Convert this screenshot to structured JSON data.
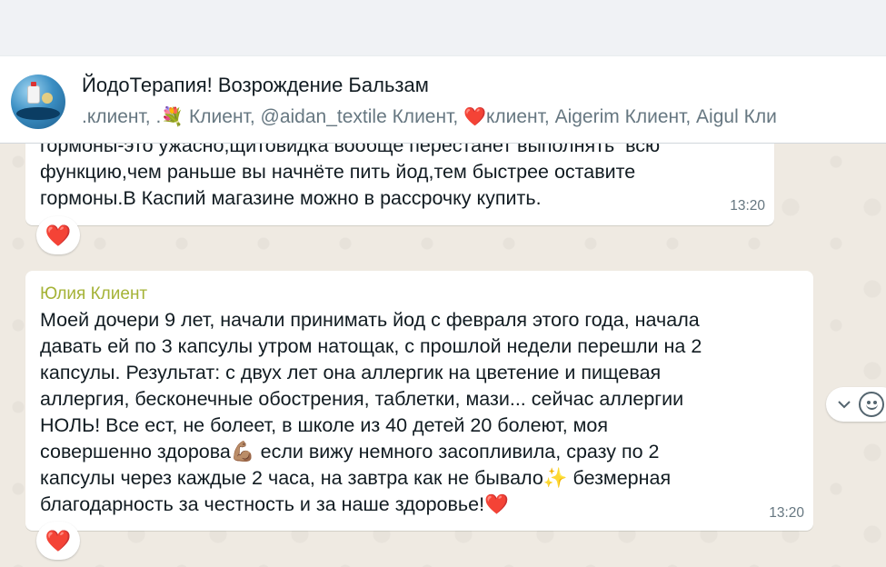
{
  "header": {
    "title": "ЙодоТерапия! Возрождение Бальзам",
    "members": [
      {
        "text": ".клиент, ."
      },
      {
        "emoji": "💐"
      },
      {
        "text": " Клиент, @aidan_textile Клиент, "
      },
      {
        "emoji": "❤️"
      },
      {
        "text": "клиент, Aigerim Клиент, Aigul Кли"
      }
    ]
  },
  "messages": [
    {
      "text": "гормоны-это ужасно,щитовидка вообще перестанет выполнять  всю\nфункцию,чем раньше вы начнёте пить йод,тем быстрее оставите\nгормоны.В Каспий магазине можно в рассрочку купить.",
      "time": "13:20",
      "reaction": "❤️"
    },
    {
      "sender": "Юлия Клиент",
      "text": "Моей дочери 9 лет, начали принимать йод с февраля этого года, начала\nдавать ей по 3 капсулы утром натощак, с прошлой недели перешли на 2\nкапсулы. Результат: с двух лет она аллергик на цветение и пищевая\nаллергия, бесконечные обострения, таблетки, мази... сейчас аллергии\nНОЛЬ! Все ест, не болеет, в школе из 40 детей 20 болеют, моя\nсовершенно здорова💪🏽 если вижу немного засопливила, сразу по 2\nкапсулы через каждые 2 часа, на завтра как не бывало✨ безмерная\nблагодарность за честность и за наше здоровье!❤️",
      "time": "13:20",
      "reaction": "❤️"
    }
  ],
  "colors": {
    "sender": "#a5b337",
    "chat_bg": "#efeae2",
    "bubble": "#ffffff"
  },
  "icons": {
    "chevron": "chevron-down-icon",
    "emoji": "emoji-icon"
  }
}
